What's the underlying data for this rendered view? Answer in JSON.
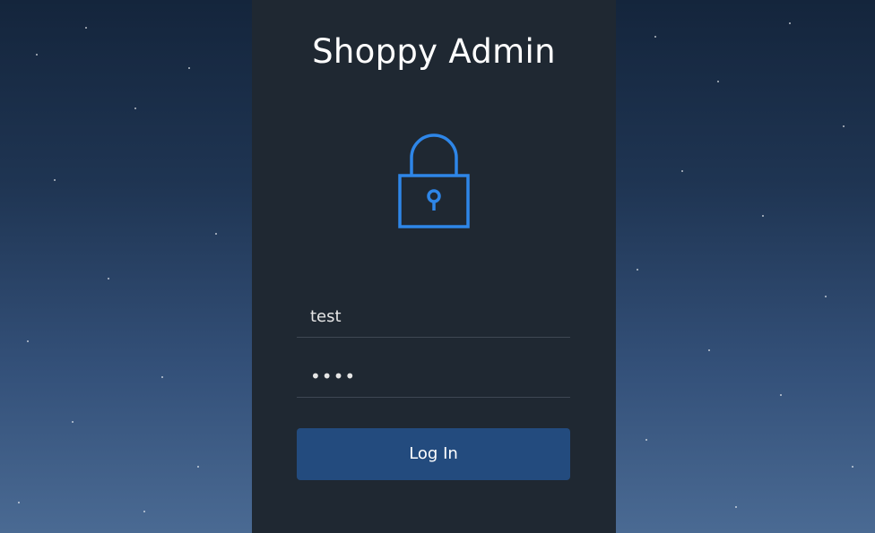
{
  "app": {
    "title": "Shoppy Admin"
  },
  "login": {
    "username_value": "test",
    "password_masked": "••••",
    "submit_label": "Log In"
  },
  "colors": {
    "panel_bg": "#1f2832",
    "accent": "#2e86e8",
    "button_bg": "#234b7e",
    "divider": "#3e4753"
  },
  "icons": {
    "lock": "lock-icon"
  }
}
